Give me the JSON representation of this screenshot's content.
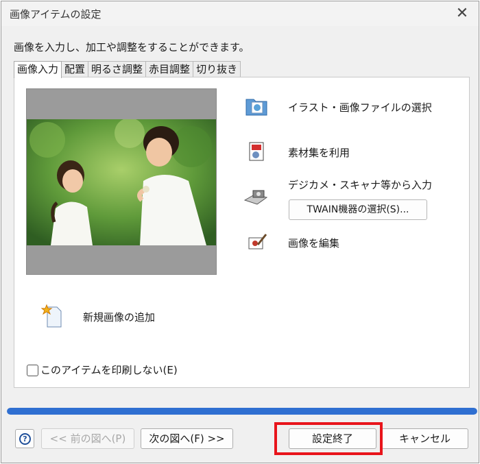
{
  "window": {
    "title": "画像アイテムの設定",
    "close_glyph": "✕"
  },
  "description": "画像を入力し、加工や調整をすることができます。",
  "tabs": [
    {
      "label": "画像入力",
      "active": true
    },
    {
      "label": "配置",
      "active": false
    },
    {
      "label": "明るさ調整",
      "active": false
    },
    {
      "label": "赤目調整",
      "active": false
    },
    {
      "label": "切り抜き",
      "active": false
    }
  ],
  "actions": {
    "select_file": {
      "label": "イラスト・画像ファイルの選択",
      "icon": "folder-picture-icon"
    },
    "material": {
      "label": "素材集を利用",
      "icon": "material-collection-icon"
    },
    "camera_input": {
      "label": "デジカメ・スキャナ等から入力",
      "icon": "camera-scanner-icon"
    },
    "twain_button": "TWAIN機器の選択(S)...",
    "edit_image": {
      "label": "画像を編集",
      "icon": "edit-image-icon"
    },
    "new_image": {
      "label": "新規画像の追加",
      "icon": "new-image-icon"
    }
  },
  "no_print": {
    "label": "このアイテムを印刷しない(E)",
    "checked": false
  },
  "progress_fraction": 1.0,
  "footer": {
    "help_glyph": "?",
    "prev_label": "<< 前の図へ(P)",
    "next_label": "次の図へ(F) >>",
    "finish_label": "設定終了",
    "cancel_label": "キャンセル"
  },
  "colors": {
    "accent": "#2f6fd1",
    "highlight": "#e8141b"
  }
}
